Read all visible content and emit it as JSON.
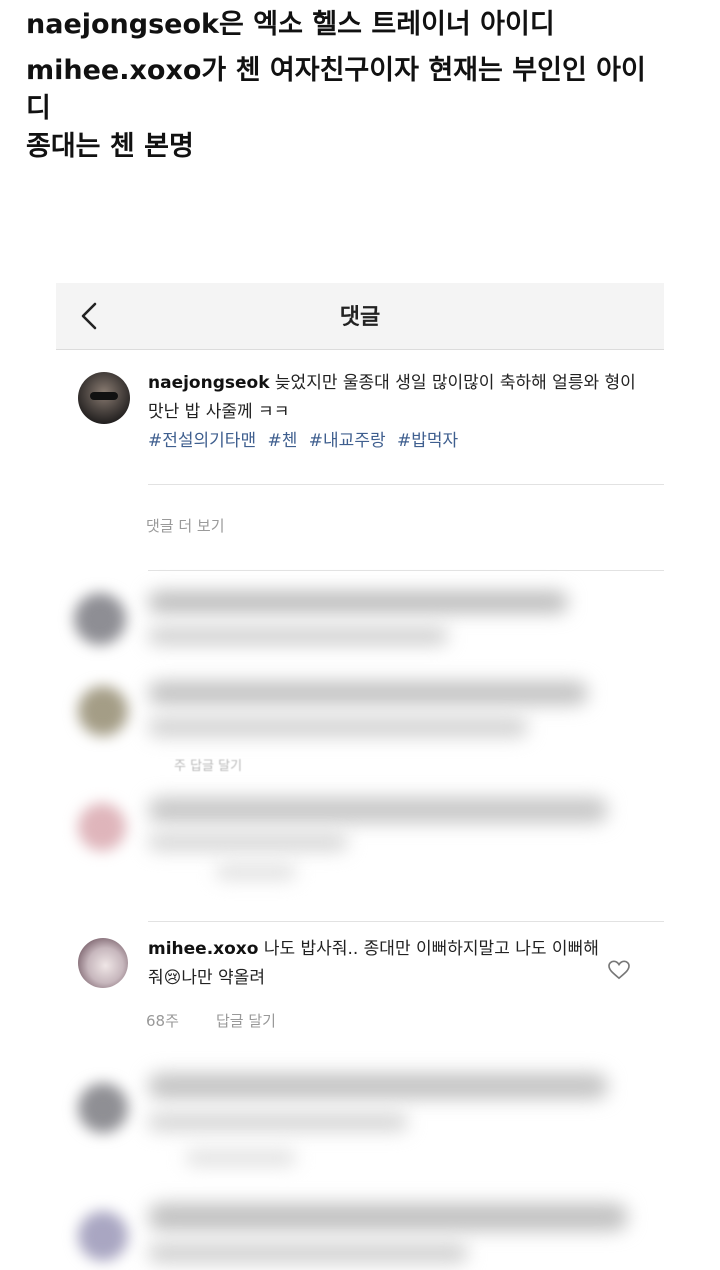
{
  "post_text": {
    "line1": "naejongseok은 엑소 헬스 트레이너 아이디",
    "line2": "mihee.xoxo가 첸 여자친구이자 현재는 부인인 아이",
    "line3": "디",
    "line4": "종대는 첸 본명"
  },
  "header": {
    "title": "댓글"
  },
  "comment1": {
    "username": "naejongseok",
    "text": " 늦었지만 울종대 생일 많이많이 축하해 얼릉와 형이 맛난 밥 사줄께 ㅋㅋ",
    "hashtags": [
      "#전설의기타맨",
      "#첸",
      "#내교주랑",
      "#밥먹자"
    ]
  },
  "view_more": "댓글 더 보기",
  "blurred_reply_label": "주   답글 달기",
  "comment2": {
    "username": "mihee.xoxo",
    "text": " 나도 밥사줘.. 종대만 이뻐하지말고 나도 이뻐해줘😢나만 약올려",
    "time": "68주",
    "reply_label": "답글 달기"
  },
  "icons": {
    "back": "chevron-left-icon",
    "like": "heart-outline-icon"
  },
  "colors": {
    "hashtag": "#3f5f8f",
    "meta_gray": "#999999",
    "nav_bg": "#f4f4f4"
  }
}
